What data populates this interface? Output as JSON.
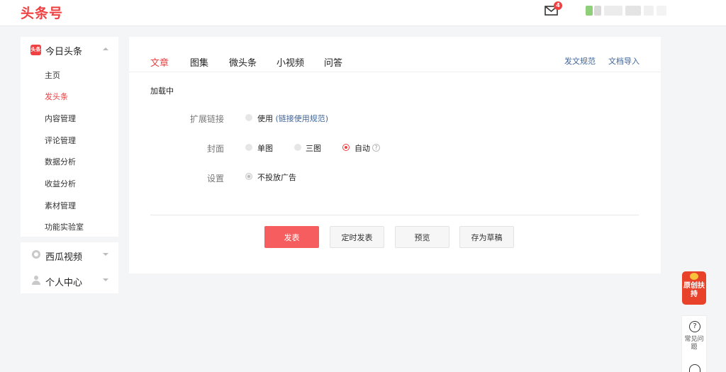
{
  "header": {
    "logo": "头条号",
    "mail_badge": "4"
  },
  "sidebar": {
    "toutiao": {
      "logo_text": "头条",
      "label": "今日头条",
      "items": [
        {
          "label": "主页"
        },
        {
          "label": "发头条"
        },
        {
          "label": "内容管理"
        },
        {
          "label": "评论管理"
        },
        {
          "label": "数据分析"
        },
        {
          "label": "收益分析"
        },
        {
          "label": "素材管理"
        },
        {
          "label": "功能实验室"
        }
      ]
    },
    "xigua": {
      "label": "西瓜视频"
    },
    "user": {
      "label": "个人中心"
    }
  },
  "tabs": {
    "items": [
      {
        "label": "文章"
      },
      {
        "label": "图集"
      },
      {
        "label": "微头条"
      },
      {
        "label": "小视频"
      },
      {
        "label": "问答"
      }
    ],
    "links": {
      "rules": "发文规范",
      "import": "文档导入"
    }
  },
  "editor": {
    "loading": "加载中",
    "ext_link": {
      "label": "扩展链接",
      "option": "使用",
      "link": "(链接使用规范)"
    },
    "cover": {
      "label": "封面",
      "options": [
        "单图",
        "三图",
        "自动"
      ],
      "help": "?"
    },
    "settings": {
      "label": "设置",
      "option": "不投放广告"
    },
    "buttons": {
      "publish": "发表",
      "schedule": "定时发表",
      "preview": "预览",
      "draft": "存为草稿"
    }
  },
  "float": {
    "original": "原创扶持",
    "help_symbol": "?",
    "help": "常见问题"
  },
  "colors": {
    "brand": "#f04142",
    "link": "#406599",
    "primary_button": "#f55d5e"
  }
}
